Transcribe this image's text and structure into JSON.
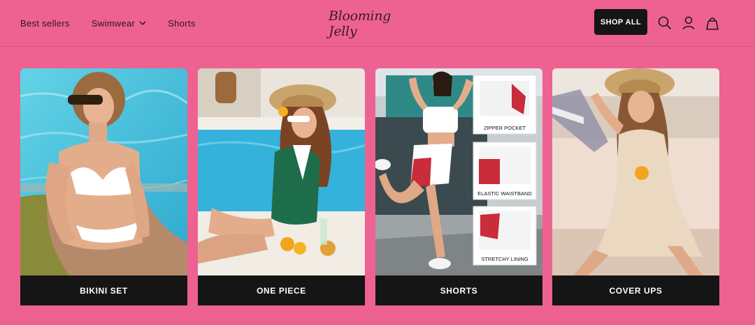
{
  "header": {
    "nav": [
      {
        "label": "Best sellers"
      },
      {
        "label": "Swimwear",
        "has_dropdown": true
      },
      {
        "label": "Shorts"
      }
    ],
    "logo_text": "Blooming Jelly",
    "shop_all_label": "SHOP ALL",
    "icons": [
      "search-icon",
      "account-icon",
      "cart-icon"
    ]
  },
  "cards": [
    {
      "label": "BIKINI SET"
    },
    {
      "label": "ONE PIECE"
    },
    {
      "label": "SHORTS",
      "callouts": [
        "ZIPPER POCKET",
        "ELASTIC WAISTBAND",
        "STRETCHY LINING"
      ]
    },
    {
      "label": "COVER UPS"
    }
  ],
  "colors": {
    "background": "#ee6292",
    "dark": "#151515",
    "text": "#2a1520"
  }
}
